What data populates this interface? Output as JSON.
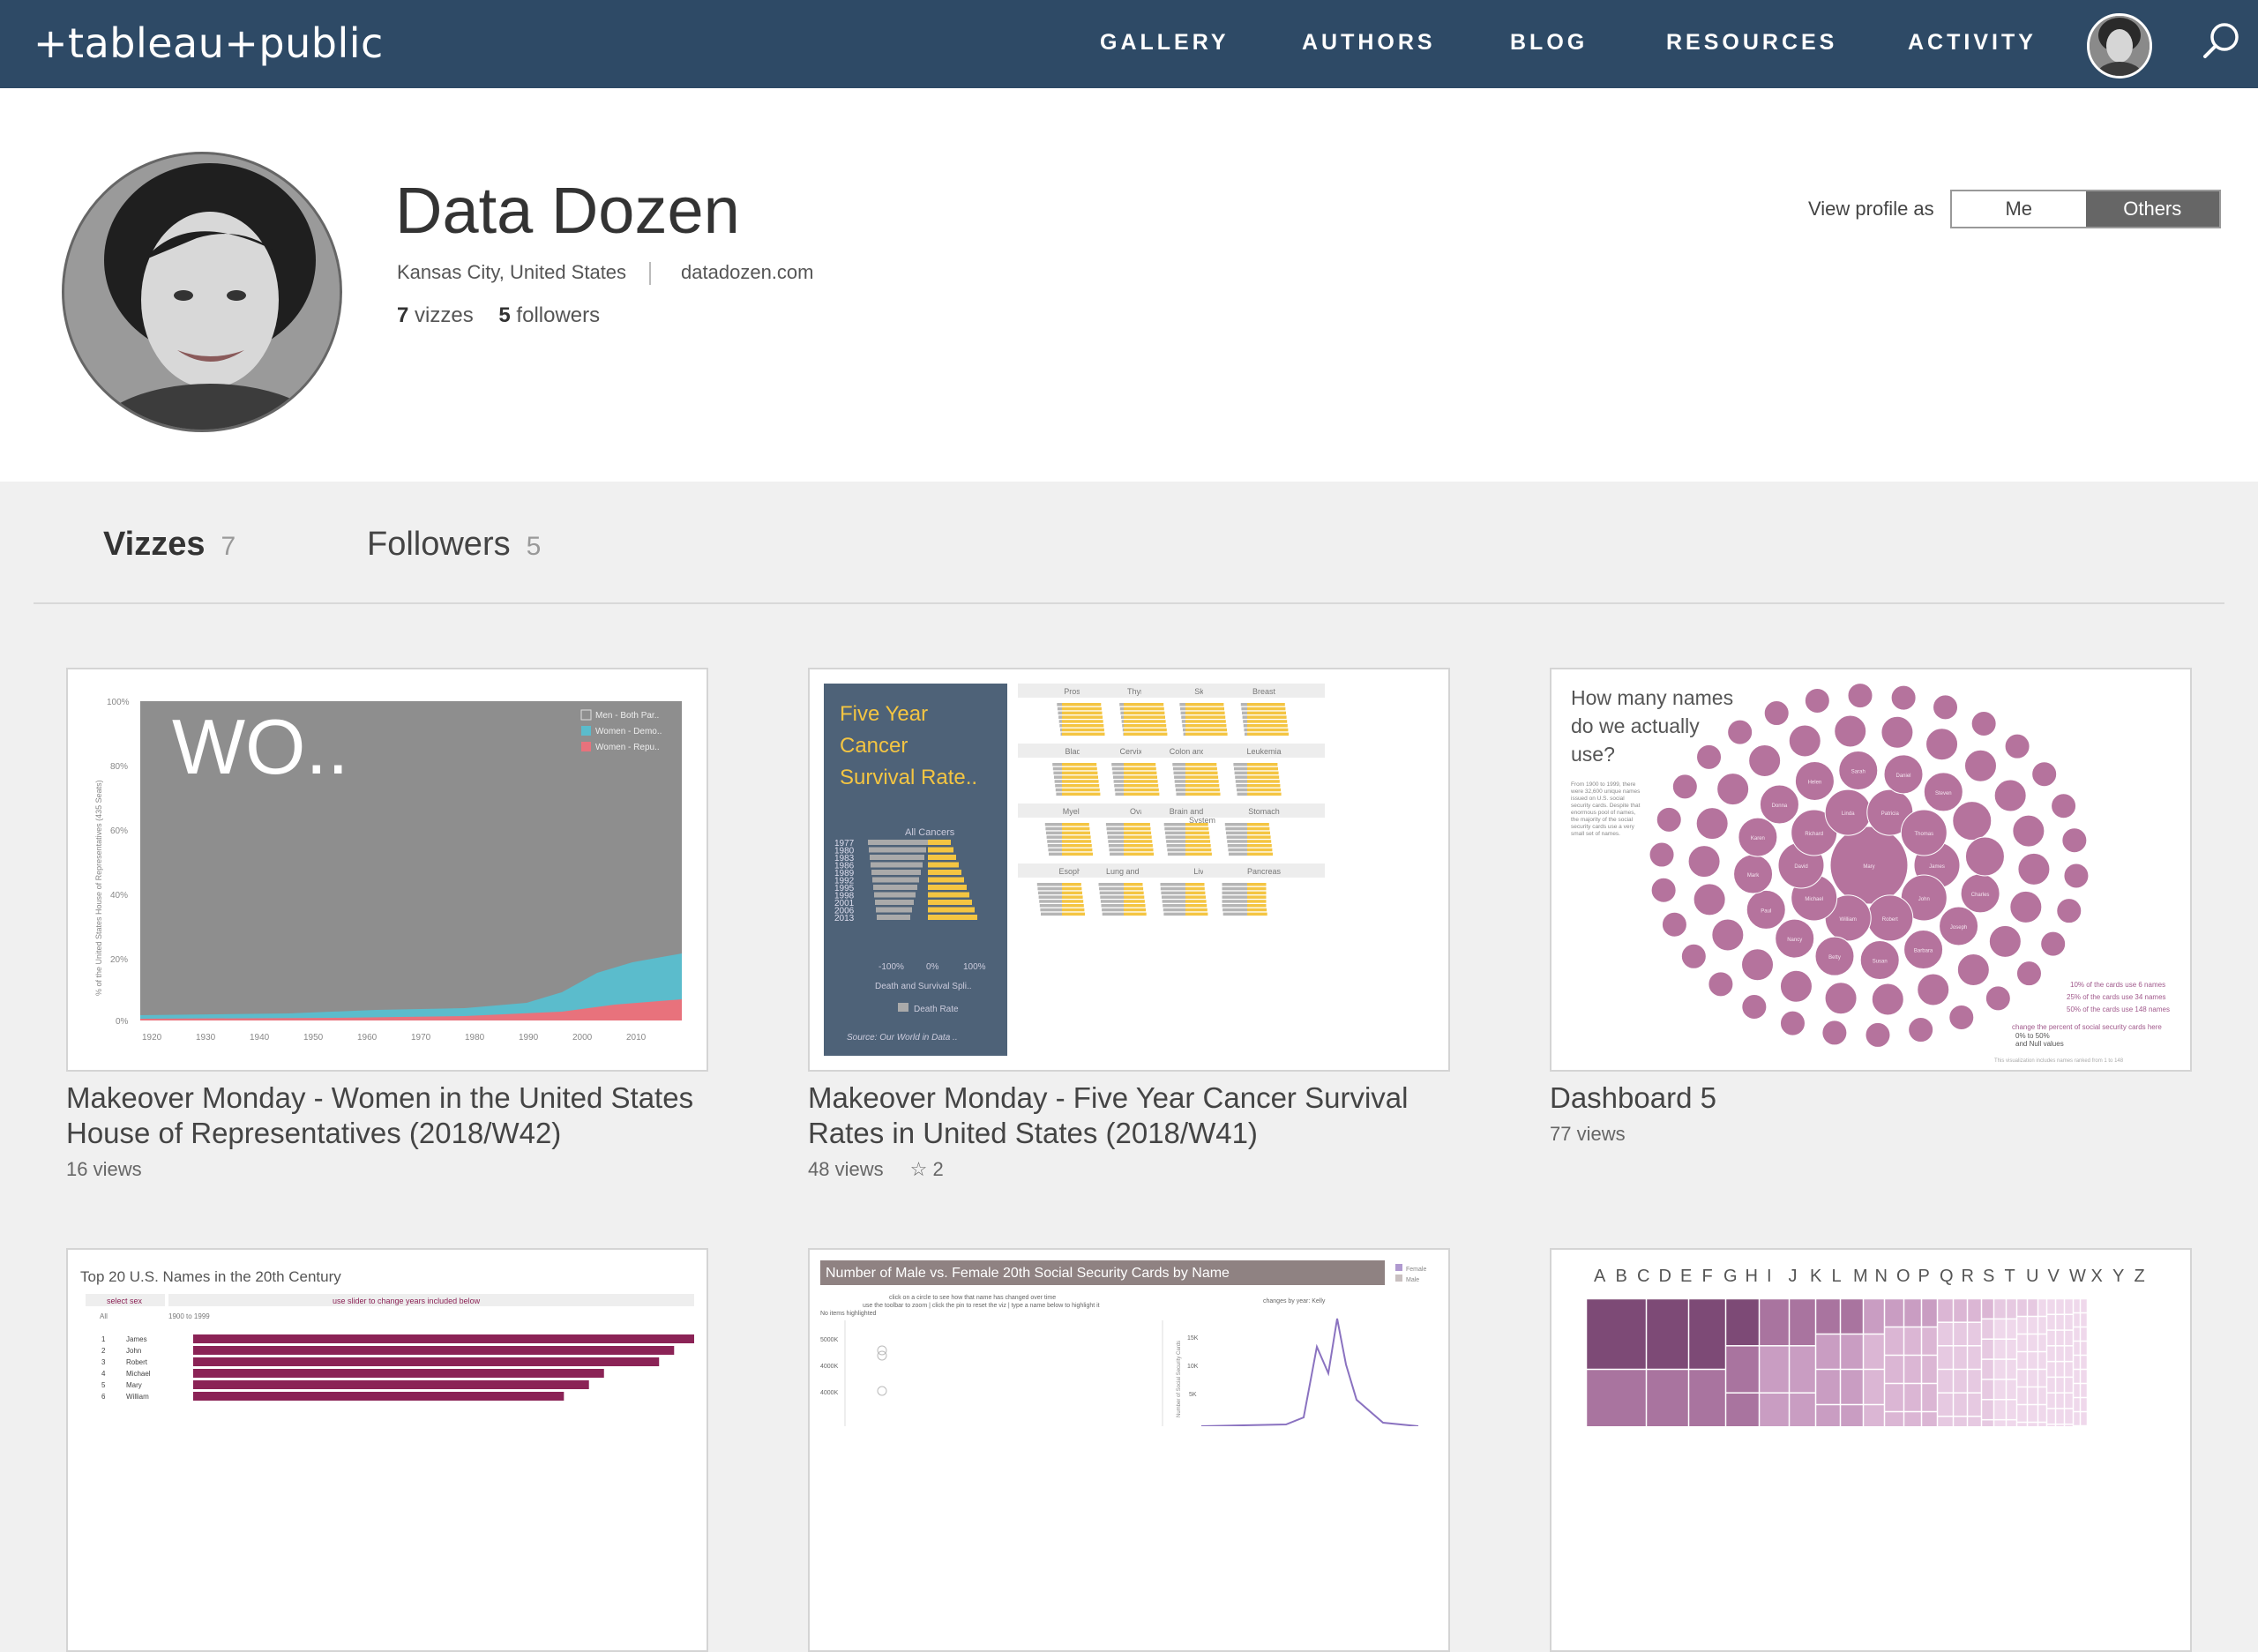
{
  "nav": {
    "logo": "+tableau+public",
    "items": [
      "GALLERY",
      "AUTHORS",
      "BLOG",
      "RESOURCES",
      "ACTIVITY"
    ]
  },
  "profile": {
    "name": "Data Dozen",
    "location": "Kansas City, United States",
    "website": "datadozen.com",
    "vizzes_count": "7",
    "vizzes_label": "vizzes",
    "followers_count": "5",
    "followers_label": "followers",
    "view_as_label": "View profile as",
    "view_as_options": [
      "Me",
      "Others"
    ],
    "view_as_selected": "Others"
  },
  "tabs": [
    {
      "label": "Vizzes",
      "count": "7",
      "active": true
    },
    {
      "label": "Followers",
      "count": "5",
      "active": false
    }
  ],
  "vizzes": [
    {
      "title": "Makeover Monday - Women in the United States House of Representatives (2018/W42)",
      "views": "16 views",
      "favorites": ""
    },
    {
      "title": "Makeover Monday - Five Year Cancer Survival Rates in United States (2018/W41)",
      "views": "48 views",
      "favorites": "2"
    },
    {
      "title": "Dashboard 5",
      "views": "77 views",
      "favorites": ""
    }
  ],
  "thumb1": {
    "big_text": "WO..",
    "ylabel": "% of the United States House of Representatives (435 Seats)",
    "y_ticks": [
      "100%",
      "80%",
      "60%",
      "40%",
      "20%",
      "0%"
    ],
    "x_ticks": [
      "1920",
      "1930",
      "1940",
      "1950",
      "1960",
      "1970",
      "1980",
      "1990",
      "2000",
      "2010"
    ],
    "legend": [
      "Men - Both Par..",
      "Women - Demo..",
      "Women - Repu.."
    ]
  },
  "thumb2": {
    "title": "Five Year Cancer Survival Rate..",
    "all_label": "All Cancers",
    "years": [
      "1977",
      "1980",
      "1983",
      "1986",
      "1989",
      "1992",
      "1995",
      "1998",
      "2001",
      "2006",
      "2013"
    ],
    "axis": [
      "-100%",
      "0%",
      "100%"
    ],
    "bottom": "Death and Survival Spli..",
    "legend": "Death Rate",
    "source": "Source: Our World in Data ..",
    "cancers": [
      "Prostate",
      "Thyroid",
      "Skin",
      "Breast",
      "Bladder",
      "Cervix Uteri",
      "Colon and Rectum",
      "Leukemia",
      "Myeloma",
      "Ovary",
      "Brain and Nervous System",
      "Stomach",
      "Esophagus",
      "Lung and Bronchus",
      "Liver",
      "Pancreas"
    ]
  },
  "thumb3": {
    "title_lines": [
      "How many names",
      "do we actually",
      "use?"
    ],
    "blurb": [
      "From 1900 to 1999, there",
      "were 32,600 unique names",
      "issued on U.S. social",
      "security cards. Despite that",
      "enormous pool of names,",
      "the majority of the social",
      "security cards use a very",
      "small set of names."
    ],
    "names": [
      "Mary",
      "James",
      "John",
      "Robert",
      "William",
      "Michael",
      "David",
      "Richard",
      "Linda",
      "Patricia",
      "Thomas",
      "Charles",
      "Joseph",
      "Barbara",
      "Susan",
      "Betty",
      "Nancy",
      "Paul",
      "Mark",
      "Karen",
      "Donna",
      "Helen",
      "Sarah",
      "Daniel",
      "Steven"
    ],
    "stats": [
      "10% of the cards use 6 names",
      "25% of the cards use 34 names",
      "50% of the cards use 148 names"
    ],
    "control": "change the percent of social security cards here",
    "control_options": [
      "0% to 50%",
      "and Null values"
    ],
    "footer": "This visualization includes names ranked from 1 to 148"
  },
  "thumb4": {
    "title": "Top 20 U.S. Names in the 20th Century",
    "filter1": "select sex",
    "filter2": "use slider to change years included below",
    "filter1_val": "All",
    "filter2_val": "1900 to 1999",
    "ranks": [
      "1",
      "2",
      "3",
      "4",
      "5",
      "6"
    ],
    "names": [
      "James",
      "John",
      "Robert",
      "Michael",
      "Mary",
      "William"
    ],
    "values": [
      100,
      96,
      93,
      82,
      79,
      74
    ]
  },
  "thumb5": {
    "title": "Number of Male vs. Female 20th Social Security Cards by Name",
    "legend": [
      "Female",
      "Male"
    ],
    "hint1": "click on a circle to see how that name has changed over time",
    "hint2": "use the toolbar to zoom | click the pin to reset the viz | type a name below to highlight it",
    "hint3": "No items highlighted",
    "right_title": "changes by year: Kelly",
    "y_ticks": [
      "5000K",
      "4000K",
      "4000K"
    ],
    "r_ticks": [
      "15K",
      "10K",
      "5K"
    ],
    "r_label": "Number of Social Security Cards"
  },
  "thumb6": {
    "letters": [
      "A",
      "B",
      "C",
      "D",
      "E",
      "F",
      "G",
      "H",
      "I",
      "J",
      "K",
      "L",
      "M",
      "N",
      "O",
      "P",
      "Q",
      "R",
      "S",
      "T",
      "U",
      "V",
      "W",
      "X",
      "Y",
      "Z"
    ]
  },
  "colors": {
    "nav_bg": "#2e4a66",
    "accent_yellow": "#f4c542",
    "accent_teal": "#5bbccc",
    "accent_red": "#e8727c",
    "accent_purple": "#b5739d",
    "accent_maroon": "#8b2356"
  }
}
